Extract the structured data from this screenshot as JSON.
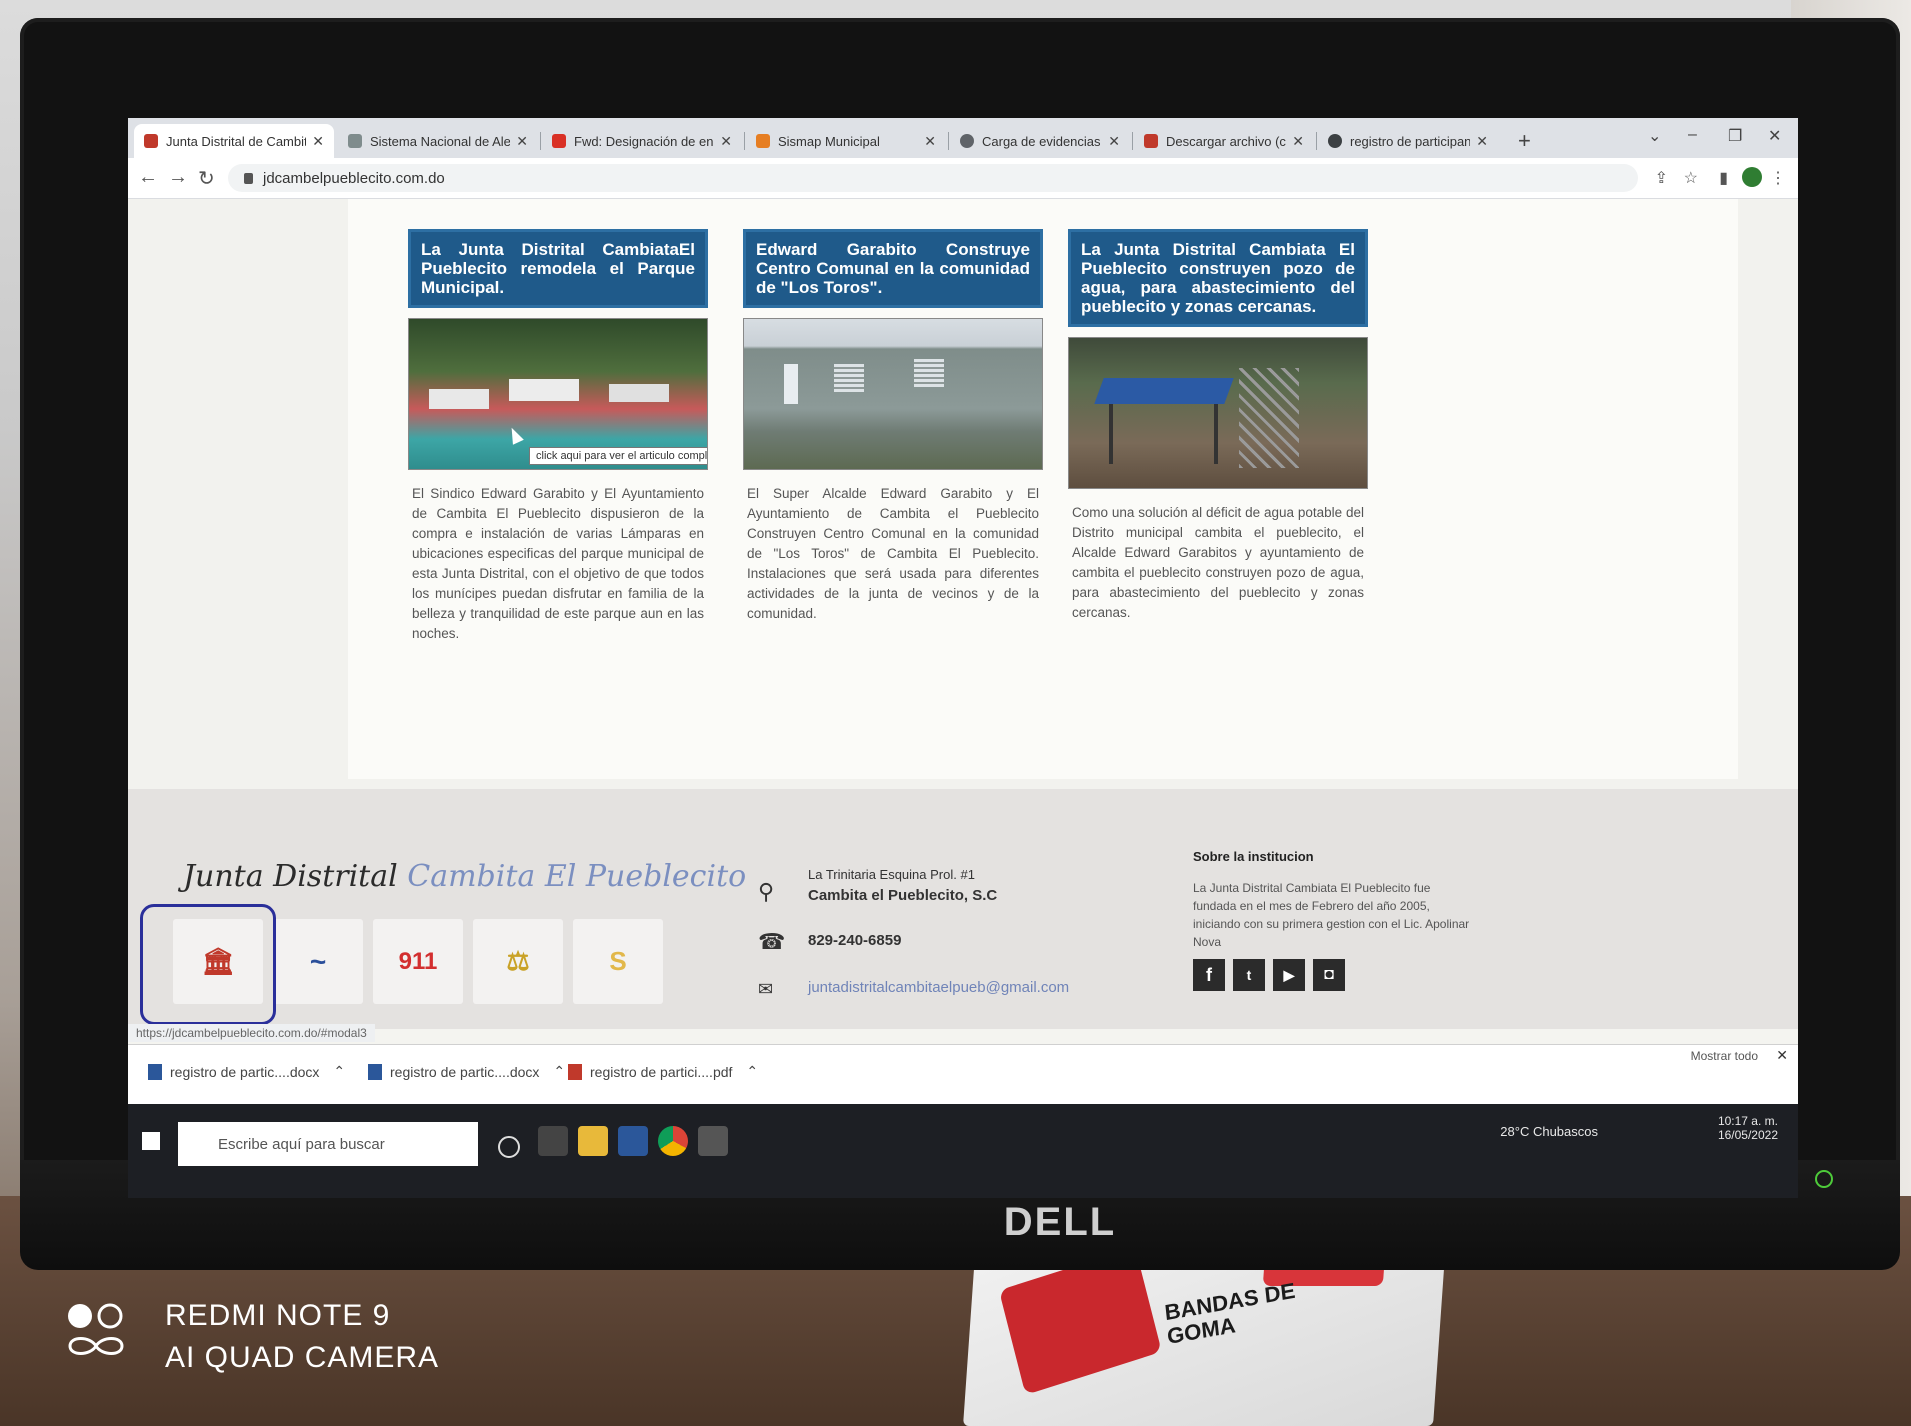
{
  "browser": {
    "tabs": [
      {
        "label": "Junta Distrital de Cambita",
        "favicon_color": "#c0392b",
        "active": true
      },
      {
        "label": "Sistema Nacional de Alert",
        "favicon_color": "#7f8c8d",
        "active": false
      },
      {
        "label": "Fwd: Designación de enla",
        "favicon_color": "#d93025",
        "active": false
      },
      {
        "label": "Sismap Municipal",
        "favicon_color": "#e67e22",
        "active": false
      },
      {
        "label": "Carga de evidencias • Ob",
        "favicon_color": "#5f6368",
        "active": false
      },
      {
        "label": "Descargar archivo (conve",
        "favicon_color": "#c0392b",
        "active": false
      },
      {
        "label": "registro de participantes",
        "favicon_color": "#3c4043",
        "active": false
      }
    ],
    "url": "jdcambelpueblecito.com.do",
    "status_url": "https://jdcambelpueblecito.com.do/#modal3"
  },
  "articles": [
    {
      "title": "La Junta Distrital CambiataEl Pueblecito remodela el Parque Municipal.",
      "text": "El Sindico Edward Garabito y El Ayuntamiento de Cambita El Pueblecito dispusieron de la compra e instalación de varias Lámparas en ubicaciones especificas del parque municipal de esta Junta Distrital, con el objetivo de que todos los munícipes puedan disfrutar en familia de la belleza y tranquilidad de este parque aun en las noches.",
      "tooltip": "click aqui para ver el articulo completo"
    },
    {
      "title": "Edward Garabito Construye Centro Comunal en la comunidad de \"Los Toros\".",
      "text": "El Super Alcalde Edward Garabito y El Ayuntamiento de Cambita el Pueblecito Construyen Centro Comunal en la comunidad de \"Los Toros\" de Cambita El Pueblecito. Instalaciones que será usada para diferentes actividades de la junta de vecinos y de la comunidad."
    },
    {
      "title": "La Junta Distrital Cambiata El Pueblecito construyen pozo de agua, para abastecimiento del pueblecito y zonas cercanas.",
      "text": "Como una solución al déficit de agua potable del Distrito municipal cambita el pueblecito, el Alcalde Edward Garabitos y ayuntamiento de cambita el pueblecito construyen pozo de agua, para abastecimiento del pueblecito y zonas cercanas."
    }
  ],
  "footer": {
    "brand_a": "Junta Distrital",
    "brand_b": "Cambita El Pueblecito",
    "logos": [
      "🏛",
      "~",
      "911",
      "⚖",
      "S"
    ],
    "address_1": "La Trinitaria Esquina Prol. #1",
    "address_2": "Cambita el Pueblecito, S.C",
    "phone": "829-240-6859",
    "email": "juntadistritalcambitaelpueb@gmail.com",
    "about_title": "Sobre la institucion",
    "about_text": "La Junta Distrital Cambiata El Pueblecito fue fundada en el mes de Febrero del año 2005, iniciando con su primera gestion con el Lic. Apolinar Nova"
  },
  "downloads": {
    "items": [
      "registro de partic....docx",
      "registro de partic....docx",
      "registro de partici....pdf"
    ],
    "show_all": "Mostrar todo"
  },
  "taskbar": {
    "search_placeholder": "Escribe aquí para buscar",
    "weather": "28°C  Chubascos",
    "time": "10:17 a. m.",
    "date": "16/05/2022"
  },
  "photo": {
    "monitor_brand": "DELL",
    "camera_line_1": "REDMI NOTE 9",
    "camera_line_2": "AI QUAD CAMERA",
    "box_text": "BANDAS DE GOMA"
  }
}
